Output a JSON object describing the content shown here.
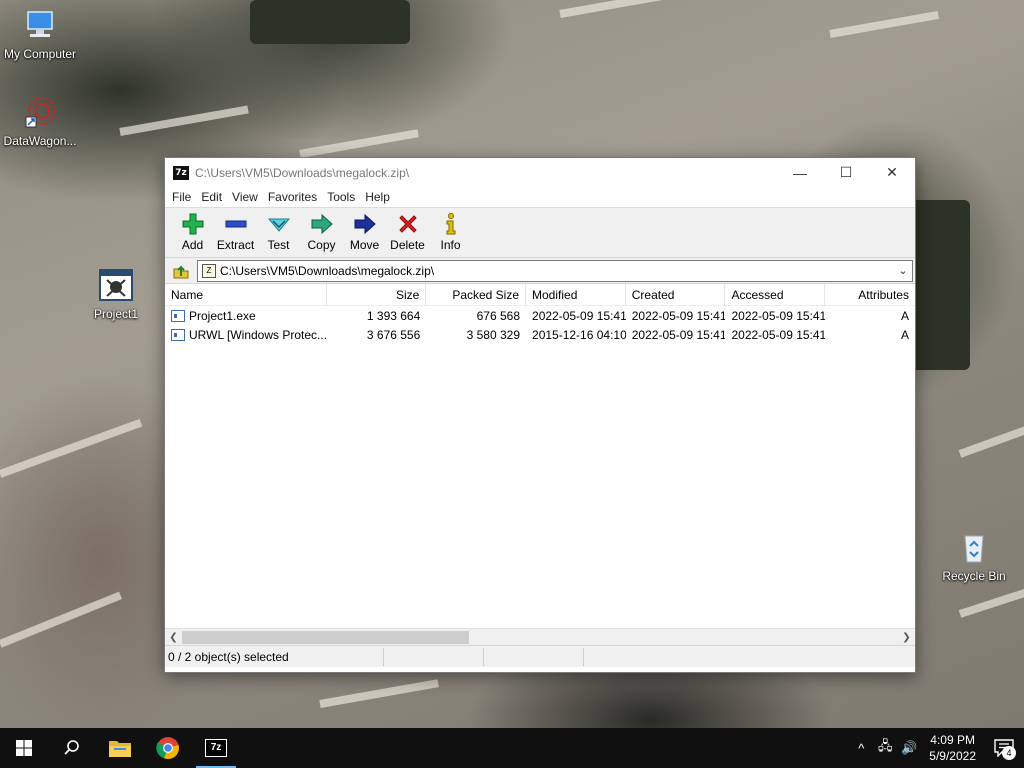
{
  "desktop": {
    "icons": [
      {
        "label": "My Computer",
        "icon": "computer-icon"
      },
      {
        "label": "DataWagon...",
        "icon": "datawagon-icon"
      },
      {
        "label": "Project1",
        "icon": "project1-icon"
      },
      {
        "label": "Recycle Bin",
        "icon": "recycle-bin-icon"
      }
    ]
  },
  "window": {
    "app_icon_text": "7z",
    "title": "C:\\Users\\VM5\\Downloads\\megalock.zip\\",
    "controls": {
      "minimize": "—",
      "maximize": "☐",
      "close": "✕"
    },
    "menu": [
      "File",
      "Edit",
      "View",
      "Favorites",
      "Tools",
      "Help"
    ],
    "toolbar": [
      {
        "label": "Add",
        "icon": "add-icon"
      },
      {
        "label": "Extract",
        "icon": "extract-icon"
      },
      {
        "label": "Test",
        "icon": "test-icon"
      },
      {
        "label": "Copy",
        "icon": "copy-icon"
      },
      {
        "label": "Move",
        "icon": "move-icon"
      },
      {
        "label": "Delete",
        "icon": "delete-icon"
      },
      {
        "label": "Info",
        "icon": "info-icon"
      }
    ],
    "address": {
      "value": "C:\\Users\\VM5\\Downloads\\megalock.zip\\",
      "zip_icon_text": "Z"
    },
    "columns": [
      "Name",
      "Size",
      "Packed Size",
      "Modified",
      "Created",
      "Accessed",
      "Attributes"
    ],
    "files": [
      {
        "name": "Project1.exe",
        "size": "1 393 664",
        "packed": "676 568",
        "modified": "2022-05-09 15:41",
        "created": "2022-05-09 15:41",
        "accessed": "2022-05-09 15:41",
        "attr": "A"
      },
      {
        "name": "URWL [Windows Protec...",
        "size": "3 676 556",
        "packed": "3 580 329",
        "modified": "2015-12-16 04:10",
        "created": "2022-05-09 15:41",
        "accessed": "2022-05-09 15:41",
        "attr": "A"
      }
    ],
    "status": {
      "selected": "0 / 2 object(s) selected",
      "cell2": "",
      "cell3": "",
      "cell4": ""
    }
  },
  "taskbar": {
    "apps": [
      {
        "name": "start",
        "icon": "windows-start-icon"
      },
      {
        "name": "search",
        "icon": "search-icon"
      },
      {
        "name": "file-explorer",
        "icon": "folder-icon"
      },
      {
        "name": "chrome",
        "icon": "chrome-icon"
      },
      {
        "name": "7zip",
        "icon": "7zip-icon",
        "label": "7z"
      }
    ],
    "tray": {
      "chevron": "^",
      "network": "🖧",
      "volume": "🔊"
    },
    "time": "4:09 PM",
    "date": "5/9/2022",
    "notification_count": "4"
  },
  "colors": {
    "accent": "#76b9ed",
    "taskbar": "#101010",
    "add_green": "#22b14c",
    "delete_red": "#e02020"
  }
}
